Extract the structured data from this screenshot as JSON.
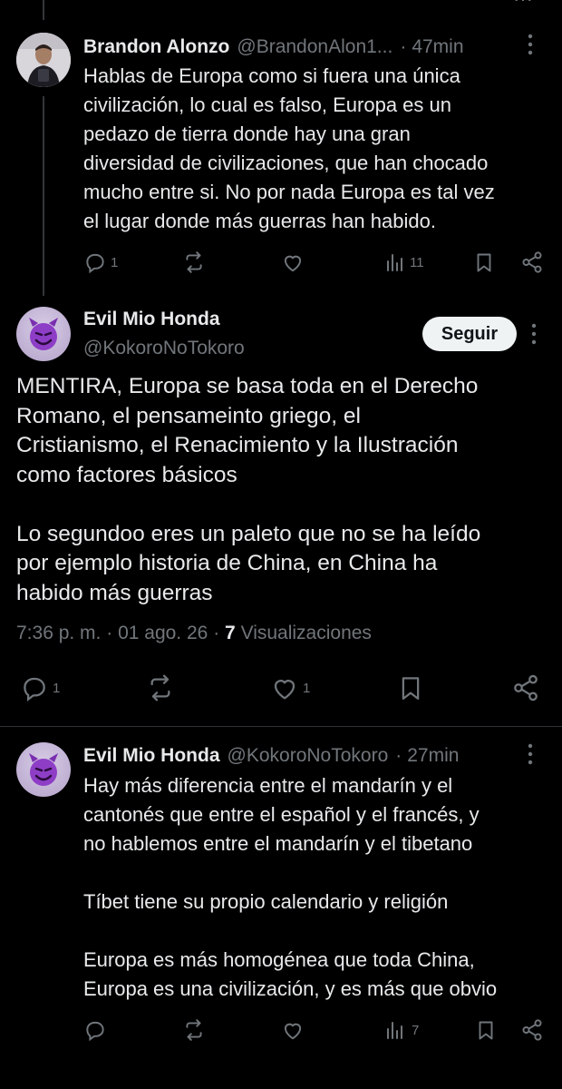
{
  "replies": [
    {
      "name": "Brandon Alonzo",
      "handle": "@BrandonAlon1...",
      "sep": "·",
      "time": "47min",
      "text": "Hablas de Europa como si fuera una única\ncivilización, lo cual es falso, Europa es un\npedazo de tierra donde hay una gran\ndiversidad de civilizaciones, que han chocado\nmucho entre si. No por nada Europa es tal vez\nel lugar donde más guerras han habido.",
      "replies_count": "1",
      "reposts_count": "",
      "likes_count": "",
      "views_count": "11"
    },
    {
      "name": "Evil Mio Honda",
      "handle": "@KokoroNoTokoro",
      "sep": "·",
      "time": "27min",
      "text": "Hay más diferencia entre el mandarín y el\ncantonés que entre el español y el francés, y\nno hablemos entre el mandarín y el tibetano\n\nTíbet tiene su propio calendario y religión\n\nEuropa es más homogénea que toda China,\nEuropa es una civilización, y es más que obvio",
      "replies_count": "",
      "reposts_count": "",
      "likes_count": "",
      "views_count": "7"
    }
  ],
  "main_post": {
    "name": "Evil Mio Honda",
    "handle": "@KokoroNoTokoro",
    "follow_label": "Seguir",
    "text": "MENTIRA, Europa se basa toda en el Derecho\nRomano, el pensameinto griego, el\nCristianismo, el Renacimiento y la Ilustración\ncomo factores básicos\n\nLo segundoo eres un paleto que no se ha leído\npor ejemplo historia de China, en China ha\nhabido más guerras",
    "time": "7:36 p. m.",
    "sep1": "·",
    "date": "01 ago. 26",
    "sep2": "·",
    "views_count": "7",
    "views_label": "Visualizaciones",
    "replies_count": "1",
    "likes_count": "1"
  },
  "more_options": "···",
  "avatar_emoji": "😈",
  "colors": {
    "background": "#000000",
    "text": "#e7e9ea",
    "muted": "#71767b",
    "divider": "#2f3336",
    "button_bg": "#eff3f4"
  },
  "icons": [
    "reply-icon",
    "repost-icon",
    "like-icon",
    "views-icon",
    "bookmark-icon",
    "share-icon",
    "more-icon"
  ]
}
